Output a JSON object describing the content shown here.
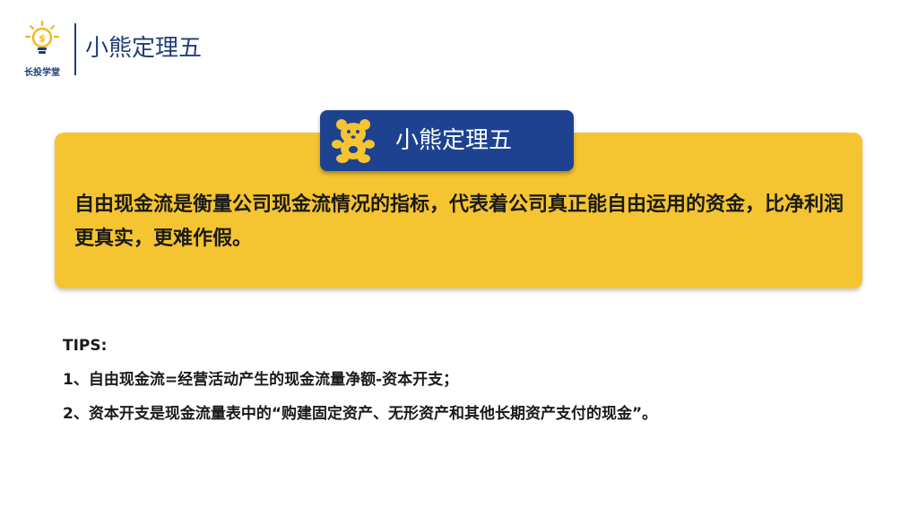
{
  "header": {
    "logo_caption": "长投学堂",
    "title": "小熊定理五"
  },
  "badge": {
    "label": "小熊定理五",
    "icon": "bear-icon"
  },
  "card": {
    "text": "自由现金流是衡量公司现金流情况的指标，代表着公司真正能自由运用的资金，比净利润更真实，更难作假。"
  },
  "tips": {
    "heading": "TIPS:",
    "items": [
      "1、自由现金流=经营活动产生的现金流量净额-资本开支；",
      "2、资本开支是现金流量表中的“购建固定资产、无形资产和其他长期资产支付的现金”。"
    ]
  },
  "colors": {
    "brand_blue": "#1d4390",
    "card_yellow": "#f5c431",
    "bear_yellow": "#f5c431"
  }
}
